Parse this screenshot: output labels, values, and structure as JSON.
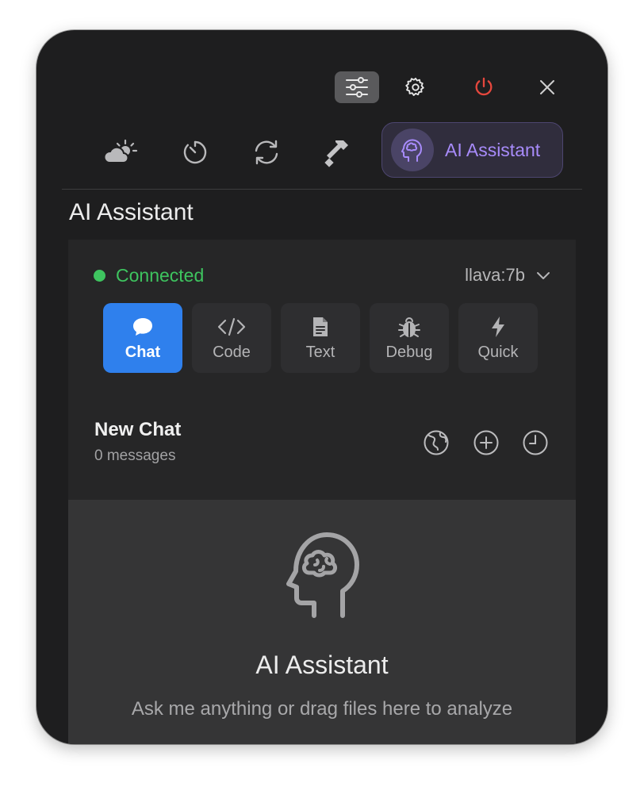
{
  "header": {
    "title": "AI Assistant"
  },
  "nav": {
    "active_label": "AI Assistant"
  },
  "status": {
    "label": "Connected",
    "color": "#3ec45f"
  },
  "model": {
    "selected": "llava:7b"
  },
  "modes": [
    {
      "label": "Chat",
      "icon": "chat-bubble-icon",
      "active": true
    },
    {
      "label": "Code",
      "icon": "code-brackets-icon",
      "active": false
    },
    {
      "label": "Text",
      "icon": "document-icon",
      "active": false
    },
    {
      "label": "Debug",
      "icon": "bug-icon",
      "active": false
    },
    {
      "label": "Quick",
      "icon": "bolt-icon",
      "active": false
    }
  ],
  "chat": {
    "title": "New Chat",
    "message_count": "0 messages"
  },
  "empty_state": {
    "title": "AI Assistant",
    "subtitle": "Ask me anything or drag files here to analyze"
  },
  "colors": {
    "accent": "#a78bfa",
    "primary_button": "#2f80ed",
    "power": "#e5473d"
  }
}
